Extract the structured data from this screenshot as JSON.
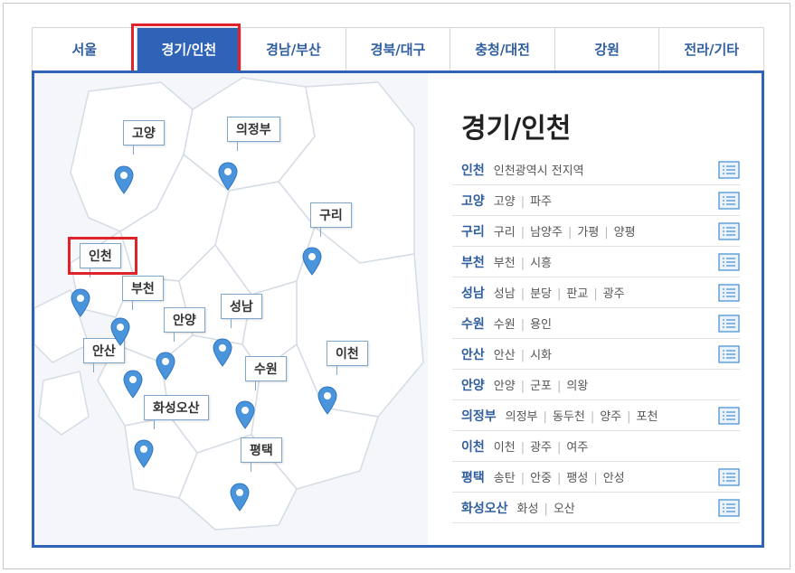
{
  "tabs": [
    {
      "label": "서울",
      "active": false
    },
    {
      "label": "경기/인천",
      "active": true
    },
    {
      "label": "경남/부산",
      "active": false
    },
    {
      "label": "경북/대구",
      "active": false
    },
    {
      "label": "충청/대전",
      "active": false
    },
    {
      "label": "강원",
      "active": false
    },
    {
      "label": "전라/기타",
      "active": false
    }
  ],
  "region_title": "경기/인천",
  "map_labels": {
    "goyang": "고양",
    "uijeongbu": "의정부",
    "guri": "구리",
    "incheon": "인천",
    "bucheon": "부천",
    "anyang": "안양",
    "seongnam": "성남",
    "ansan": "안산",
    "suwon": "수원",
    "icheon": "이천",
    "hwaseong_osan": "화성오산",
    "pyeongtaek": "평택"
  },
  "rows": [
    {
      "name": "인천",
      "items": [
        "인천광역시 전지역"
      ],
      "icon": true
    },
    {
      "name": "고양",
      "items": [
        "고양",
        "파주"
      ],
      "icon": true
    },
    {
      "name": "구리",
      "items": [
        "구리",
        "남양주",
        "가평",
        "양평"
      ],
      "icon": true
    },
    {
      "name": "부천",
      "items": [
        "부천",
        "시흥"
      ],
      "icon": true
    },
    {
      "name": "성남",
      "items": [
        "성남",
        "분당",
        "판교",
        "광주"
      ],
      "icon": true
    },
    {
      "name": "수원",
      "items": [
        "수원",
        "용인"
      ],
      "icon": true
    },
    {
      "name": "안산",
      "items": [
        "안산",
        "시화"
      ],
      "icon": true
    },
    {
      "name": "안양",
      "items": [
        "안양",
        "군포",
        "의왕"
      ],
      "icon": false
    },
    {
      "name": "의정부",
      "items": [
        "의정부",
        "동두천",
        "양주",
        "포천"
      ],
      "icon": true
    },
    {
      "name": "이천",
      "items": [
        "이천",
        "광주",
        "여주"
      ],
      "icon": false
    },
    {
      "name": "평택",
      "items": [
        "송탄",
        "안중",
        "팽성",
        "안성"
      ],
      "icon": true
    },
    {
      "name": "화성오산",
      "items": [
        "화성",
        "오산"
      ],
      "icon": true
    }
  ],
  "colors": {
    "accent": "#2f63b8",
    "highlight": "#e0222a",
    "pin": "#4a94dc",
    "row_name": "#2f5e9e"
  },
  "icons": {
    "pin": "map-pin-icon",
    "doc": "document-list-icon"
  }
}
